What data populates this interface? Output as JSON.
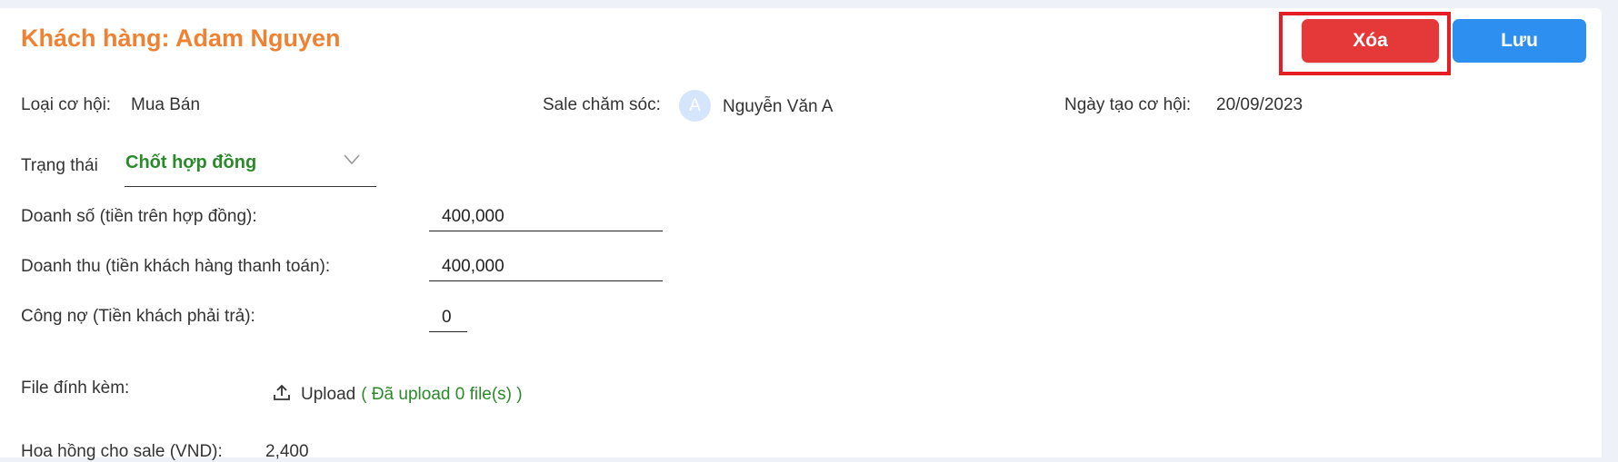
{
  "header": {
    "title": "Khách hàng: Adam Nguyen",
    "delete_label": "Xóa",
    "save_label": "Lưu"
  },
  "info": {
    "opportunity_type_label": "Loại cơ hội:",
    "opportunity_type_value": "Mua Bán",
    "sale_label": "Sale chăm sóc:",
    "sale_avatar_initial": "A",
    "sale_name": "Nguyễn Văn A",
    "created_date_label": "Ngày tạo cơ hội:",
    "created_date_value": "20/09/2023"
  },
  "status": {
    "label": "Trạng thái",
    "value": "Chốt hợp đồng"
  },
  "fields": {
    "sales_label": "Doanh số (tiền trên hợp đồng):",
    "sales_value": "400,000",
    "revenue_label": "Doanh thu (tiền khách hàng thanh toán):",
    "revenue_value": "400,000",
    "debt_label": "Công nợ (Tiền khách phải trả):",
    "debt_value": "0"
  },
  "attachment": {
    "label": "File đính kèm:",
    "upload_label": "Upload",
    "upload_count": "( Đã upload 0 file(s) )"
  },
  "commission": {
    "label": "Hoa hồng cho sale (VND):",
    "value": "2,400"
  },
  "colors": {
    "title": "#ef8232",
    "delete": "#e53838",
    "save": "#2d8ff0",
    "status": "#2a8a2a",
    "highlight": "#e51e25"
  },
  "icons": {
    "status_dropdown": "chevron-down-icon",
    "upload": "upload-icon"
  }
}
